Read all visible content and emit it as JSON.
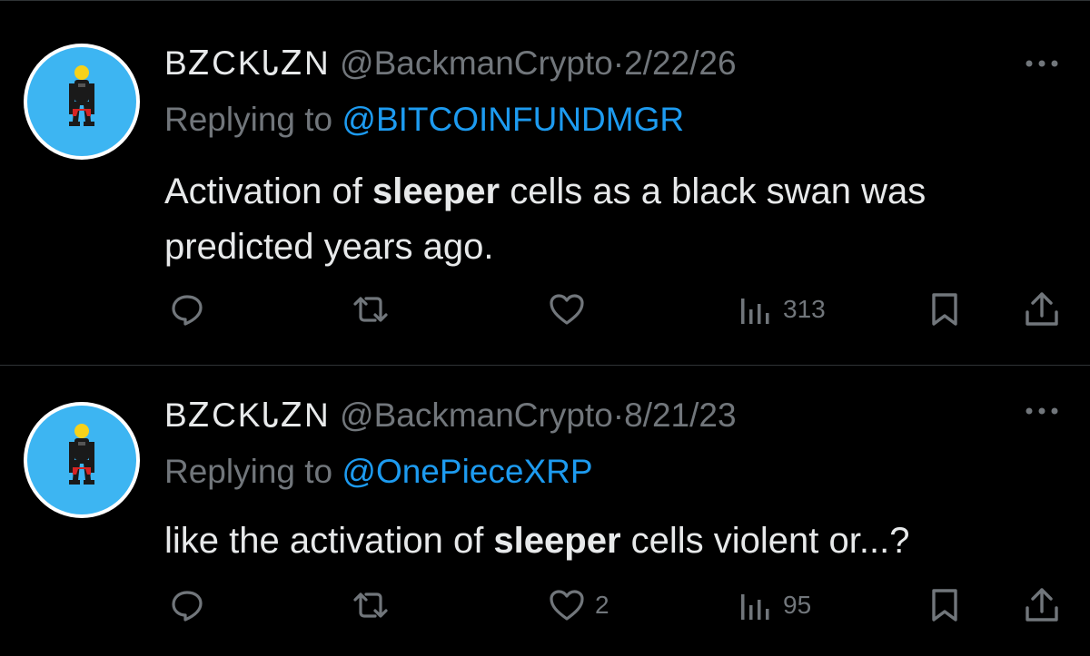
{
  "tweets": [
    {
      "display_name": "BᏃCKᏓᏃN",
      "handle": "@BackmanCrypto",
      "separator": "·",
      "date": "2/22/26",
      "replying_prefix": "Replying to ",
      "replying_to": "@BITCOINFUNDMGR",
      "text_before": "Activation of ",
      "text_bold": "sleeper",
      "text_after": " cells as a black swan was predicted years ago.",
      "likes": "",
      "views": "313",
      "avatar_icon": "avatar-figure",
      "more_icon": "more-dots-icon"
    },
    {
      "display_name": "BᏃCKᏓᏃN",
      "handle": "@BackmanCrypto",
      "separator": "·",
      "date": "8/21/23",
      "replying_prefix": "Replying to ",
      "replying_to": "@OnePieceXRP",
      "text_before": "like the activation of ",
      "text_bold": "sleeper",
      "text_after": " cells violent or...?",
      "likes": "2",
      "views": "95",
      "avatar_icon": "avatar-figure",
      "more_icon": "more-dots-icon"
    }
  ],
  "colors": {
    "background": "#000000",
    "text_primary": "#e7e9ea",
    "text_secondary": "#71767b",
    "link": "#1d9bf0",
    "avatar_ring": "#ffffff",
    "avatar_fill": "#3db5f2",
    "divider": "#2f3336"
  }
}
